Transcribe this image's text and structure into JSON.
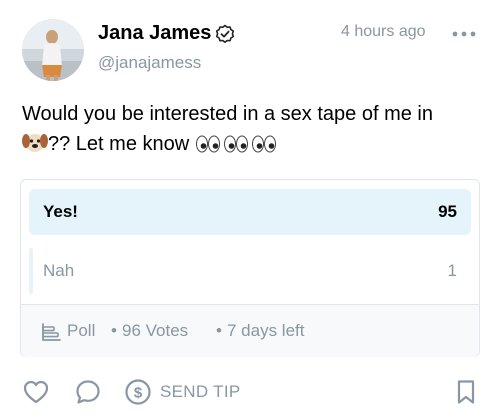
{
  "post": {
    "author": {
      "name": "Jana James",
      "handle": "@janajamess",
      "verified": true
    },
    "timestamp": "4 hours ago",
    "text_line1": "Would you be interested in a sex tape of me in",
    "text_line2_suffix": "?? Let me know",
    "emojis": {
      "inline": "dog-face-emoji",
      "eyes_count": 3
    }
  },
  "poll": {
    "options": [
      {
        "label": "Yes!",
        "votes": "95",
        "selected": true
      },
      {
        "label": "Nah",
        "votes": "1",
        "selected": false
      }
    ],
    "footer": {
      "type_label": "Poll",
      "separator": "•",
      "votes_label": "96 Votes",
      "time_left": "7 days left"
    }
  },
  "actions": {
    "tip_label": "SEND TIP"
  },
  "colors": {
    "muted": "#8a96a3",
    "poll_highlight": "#e5f4fb",
    "border": "#e0e6eb"
  }
}
